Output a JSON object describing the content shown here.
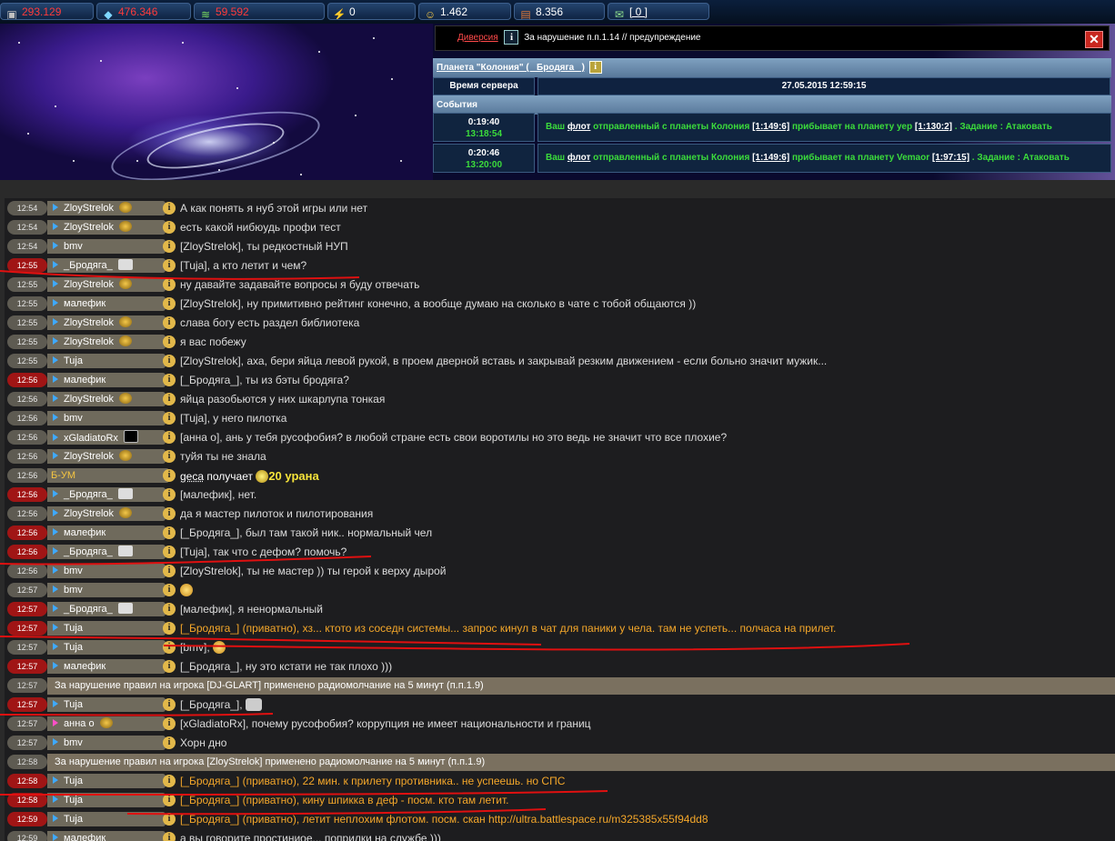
{
  "resources": [
    {
      "name": "metal",
      "value": "293.129",
      "color": "#ff3b3b",
      "icon": "metal-icon"
    },
    {
      "name": "crystal",
      "value": "476.346",
      "color": "#ff3b3b",
      "icon": "diamond-icon"
    },
    {
      "name": "deuterium",
      "value": "59.592",
      "color": "#ff3b3b",
      "icon": "deuterium-icon"
    },
    {
      "name": "energy",
      "value": "0",
      "color": "#ffffff",
      "icon": "lightning-icon"
    },
    {
      "name": "credits",
      "value": "1.462",
      "color": "#ffffff",
      "icon": "smiley-coin-icon"
    },
    {
      "name": "premium",
      "value": "8.356",
      "color": "#ffffff",
      "icon": "cargo-icon"
    },
    {
      "name": "messages",
      "value": "[ 0 ]",
      "color": "#ffffff",
      "icon": "envelope-icon"
    }
  ],
  "warning": {
    "link": "Диверсия",
    "text": "За нарушение п.п.1.14 // предупреждение",
    "info": "i",
    "close": "✕"
  },
  "planet": {
    "title": "Планета \"Колония\" ( _Бродяга_ )",
    "info": "i"
  },
  "server_time": {
    "label": "Время сервера",
    "value": "27.05.2015 12:59:15"
  },
  "events_label": "События",
  "events": [
    {
      "remaining": "0:19:40",
      "arrival": "13:18:54",
      "pre": "Ваш ",
      "fleet": "флот",
      "mid1": " отправленный с планеты Колония ",
      "from": "[1:149:6]",
      "mid2": " прибывает на планету уер ",
      "to": "[1:130:2]",
      "post": " . Задание : Атаковать"
    },
    {
      "remaining": "0:20:46",
      "arrival": "13:20:00",
      "pre": "Ваш ",
      "fleet": "флот",
      "mid1": " отправленный с планеты Колония ",
      "from": "[1:149:6]",
      "mid2": " прибывает на планету Vemaor ",
      "to": "[1:97:15]",
      "post": " . Задание : Атаковать"
    }
  ],
  "info_glyph": "i",
  "chat": [
    {
      "time": "12:54",
      "red": false,
      "user": "ZloyStrelok",
      "badge": "medal",
      "text": "А как понять я нуб этой игры или нет"
    },
    {
      "time": "12:54",
      "red": false,
      "user": "ZloyStrelok",
      "badge": "medal",
      "text": "есть какой нибюудь профи тест"
    },
    {
      "time": "12:54",
      "red": false,
      "user": "bmv",
      "badge": "",
      "text": "[ZloyStrelok], ты редкостный НУП"
    },
    {
      "time": "12:55",
      "red": true,
      "user": "_Бродяга_",
      "badge": "alien",
      "text": "[Tuja], а кто летит и чем?"
    },
    {
      "time": "12:55",
      "red": false,
      "user": "ZloyStrelok",
      "badge": "medal",
      "text": "ну давайте задавайте вопросы я буду отвечать"
    },
    {
      "time": "12:55",
      "red": false,
      "user": "малефик",
      "badge": "",
      "text": "[ZloyStrelok], ну примитивно рейтинг конечно, а вообще думаю на сколько в чате с тобой общаются ))"
    },
    {
      "time": "12:55",
      "red": false,
      "user": "ZloyStrelok",
      "badge": "medal",
      "text": "слава богу есть раздел библиотека"
    },
    {
      "time": "12:55",
      "red": false,
      "user": "ZloyStrelok",
      "badge": "medal",
      "text": "я вас побежу"
    },
    {
      "time": "12:55",
      "red": false,
      "user": "Tuja",
      "badge": "",
      "text": "[ZloyStrelok], аха, бери яйца левой рукой, в проем дверной вставь и закрывай резким движением - если больно значит мужик..."
    },
    {
      "time": "12:56",
      "red": true,
      "user": "малефик",
      "badge": "",
      "text": "[_Бродяга_], ты из бэты бродяга?"
    },
    {
      "time": "12:56",
      "red": false,
      "user": "ZloyStrelok",
      "badge": "medal",
      "text": "яйца разобьются у них шкарлупа тонкая"
    },
    {
      "time": "12:56",
      "red": false,
      "user": "bmv",
      "badge": "",
      "text": "[Tuja], у него пилотка"
    },
    {
      "time": "12:56",
      "red": false,
      "user": "xGladiatoRx",
      "badge": "skull",
      "text": "[анна о], ань у тебя русофобия? в любой стране есть свои воротилы но это ведь не значит что все плохие?"
    },
    {
      "time": "12:56",
      "red": false,
      "user": "ZloyStrelok",
      "badge": "medal",
      "text": "туйя ты не знала"
    },
    {
      "time": "12:56",
      "red": false,
      "user": "Б-УМ",
      "badge": "",
      "gift": true,
      "text": "",
      "g_name": "geca",
      "g_mid": " получает ",
      "g_amount": "20 урана"
    },
    {
      "time": "12:56",
      "red": true,
      "user": "_Бродяга_",
      "badge": "alien",
      "text": "[малефик], нет."
    },
    {
      "time": "12:56",
      "red": false,
      "user": "ZloyStrelok",
      "badge": "medal",
      "text": "да я мастер пилоток и пилотирования"
    },
    {
      "time": "12:56",
      "red": true,
      "user": "малефик",
      "badge": "",
      "text": "[_Бродяга_], был там такой ник.. нормальный чел"
    },
    {
      "time": "12:56",
      "red": true,
      "user": "_Бродяга_",
      "badge": "alien",
      "text": "[Tuja], так что с дефом? помочь?"
    },
    {
      "time": "12:56",
      "red": false,
      "user": "bmv",
      "badge": "",
      "text": "[ZloyStrelok], ты не мастер )) ты герой к верху дырой"
    },
    {
      "time": "12:57",
      "red": false,
      "user": "bmv",
      "badge": "",
      "text": "",
      "emo": true
    },
    {
      "time": "12:57",
      "red": true,
      "user": "_Бродяга_",
      "badge": "alien",
      "text": "[малефик], я ненормальный"
    },
    {
      "time": "12:57",
      "red": true,
      "user": "Tuja",
      "badge": "",
      "priv": true,
      "text": "[_Бродяга_] (приватно), хз... ктото из соседн системы... запрос кинул в чат для паники у чела. там не успеть... полчаса на прилет."
    },
    {
      "time": "12:57",
      "red": false,
      "user": "Tuja",
      "badge": "",
      "text": "[bmv], ",
      "emo": true
    },
    {
      "time": "12:57",
      "red": true,
      "user": "малефик",
      "badge": "",
      "text": "[_Бродяга_], ну это кстати не так плохо )))"
    },
    {
      "time": "12:57",
      "system": true,
      "text": "За нарушение правил на игрока [DJ-GLART] применено радиомолчание на 5 минут (п.п.1.9)"
    },
    {
      "time": "12:57",
      "red": true,
      "user": "Tuja",
      "badge": "",
      "text": "[_Бродяга_], ",
      "emo": true,
      "emo_wide": true
    },
    {
      "time": "12:57",
      "red": false,
      "user": "анна о",
      "badge": "medal",
      "pink": true,
      "text": "[xGladiatoRx], почему русофобия? коррупция не имеет национальности и границ"
    },
    {
      "time": "12:57",
      "red": false,
      "user": "bmv",
      "badge": "",
      "text": "Хорн дно"
    },
    {
      "time": "12:58",
      "system": true,
      "text": "За нарушение правил на игрока [ZloyStrelok] применено радиомолчание на 5 минут (п.п.1.9)"
    },
    {
      "time": "12:58",
      "red": true,
      "user": "Tuja",
      "badge": "",
      "priv": true,
      "text": "[_Бродяга_] (приватно), 22 мин. к прилету противника.. не успеешь. но СПС"
    },
    {
      "time": "12:58",
      "red": true,
      "user": "Tuja",
      "badge": "",
      "priv": true,
      "text": "[_Бродяга_] (приватно), кину шпикка в деф - посм. кто там летит."
    },
    {
      "time": "12:59",
      "red": true,
      "user": "Tuja",
      "badge": "",
      "priv": true,
      "text": "[_Бродяга_] (приватно), летит неплохим флотом. посм. скан http://ultra.battlespace.ru/m325385x55f94dd8"
    },
    {
      "time": "12:59",
      "red": false,
      "user": "малефик",
      "badge": "",
      "text": "а вы говорите простиниое... поприлки на службе )))"
    }
  ]
}
